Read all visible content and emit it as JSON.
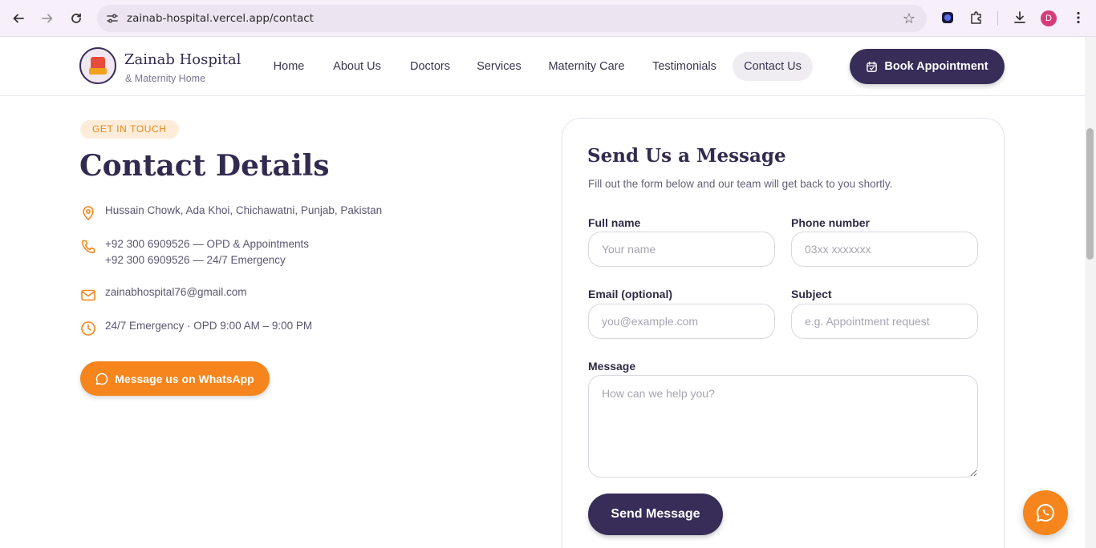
{
  "browser": {
    "url": "zainab-hospital.vercel.app/contact",
    "profile_initial": "D"
  },
  "header": {
    "brand_name": "Zainab Hospital",
    "brand_sub": "& Maternity Home",
    "nav": [
      {
        "label": "Home"
      },
      {
        "label": "About Us"
      },
      {
        "label": "Doctors"
      },
      {
        "label": "Services"
      },
      {
        "label": "Maternity Care"
      },
      {
        "label": "Testimonials"
      },
      {
        "label": "Contact Us",
        "active": true
      }
    ],
    "book_label": "Book Appointment"
  },
  "contact": {
    "badge": "GET IN TOUCH",
    "title": "Contact Details",
    "address": "Hussain Chowk, Ada Khoi, Chichawatni, Punjab, Pakistan",
    "phone_opd": "+92 300 6909526 — OPD & Appointments",
    "phone_emergency": "+92 300 6909526 — 24/7 Emergency",
    "email": "zainabhospital76@gmail.com",
    "hours": "24/7 Emergency · OPD 9:00 AM – 9:00 PM",
    "whatsapp_label": "Message us on WhatsApp"
  },
  "form": {
    "title": "Send Us a Message",
    "subtitle": "Fill out the form below and our team will get back to you shortly.",
    "full_name_label": "Full name",
    "full_name_placeholder": "Your name",
    "phone_label": "Phone number",
    "phone_placeholder": "03xx xxxxxxx",
    "email_label": "Email (optional)",
    "email_placeholder": "you@example.com",
    "subject_label": "Subject",
    "subject_placeholder": "e.g. Appointment request",
    "message_label": "Message",
    "message_placeholder": "How can we help you?",
    "submit_label": "Send Message"
  },
  "colors": {
    "primary": "#372d58",
    "accent": "#f5851c",
    "badge_bg": "#fdecd9"
  }
}
